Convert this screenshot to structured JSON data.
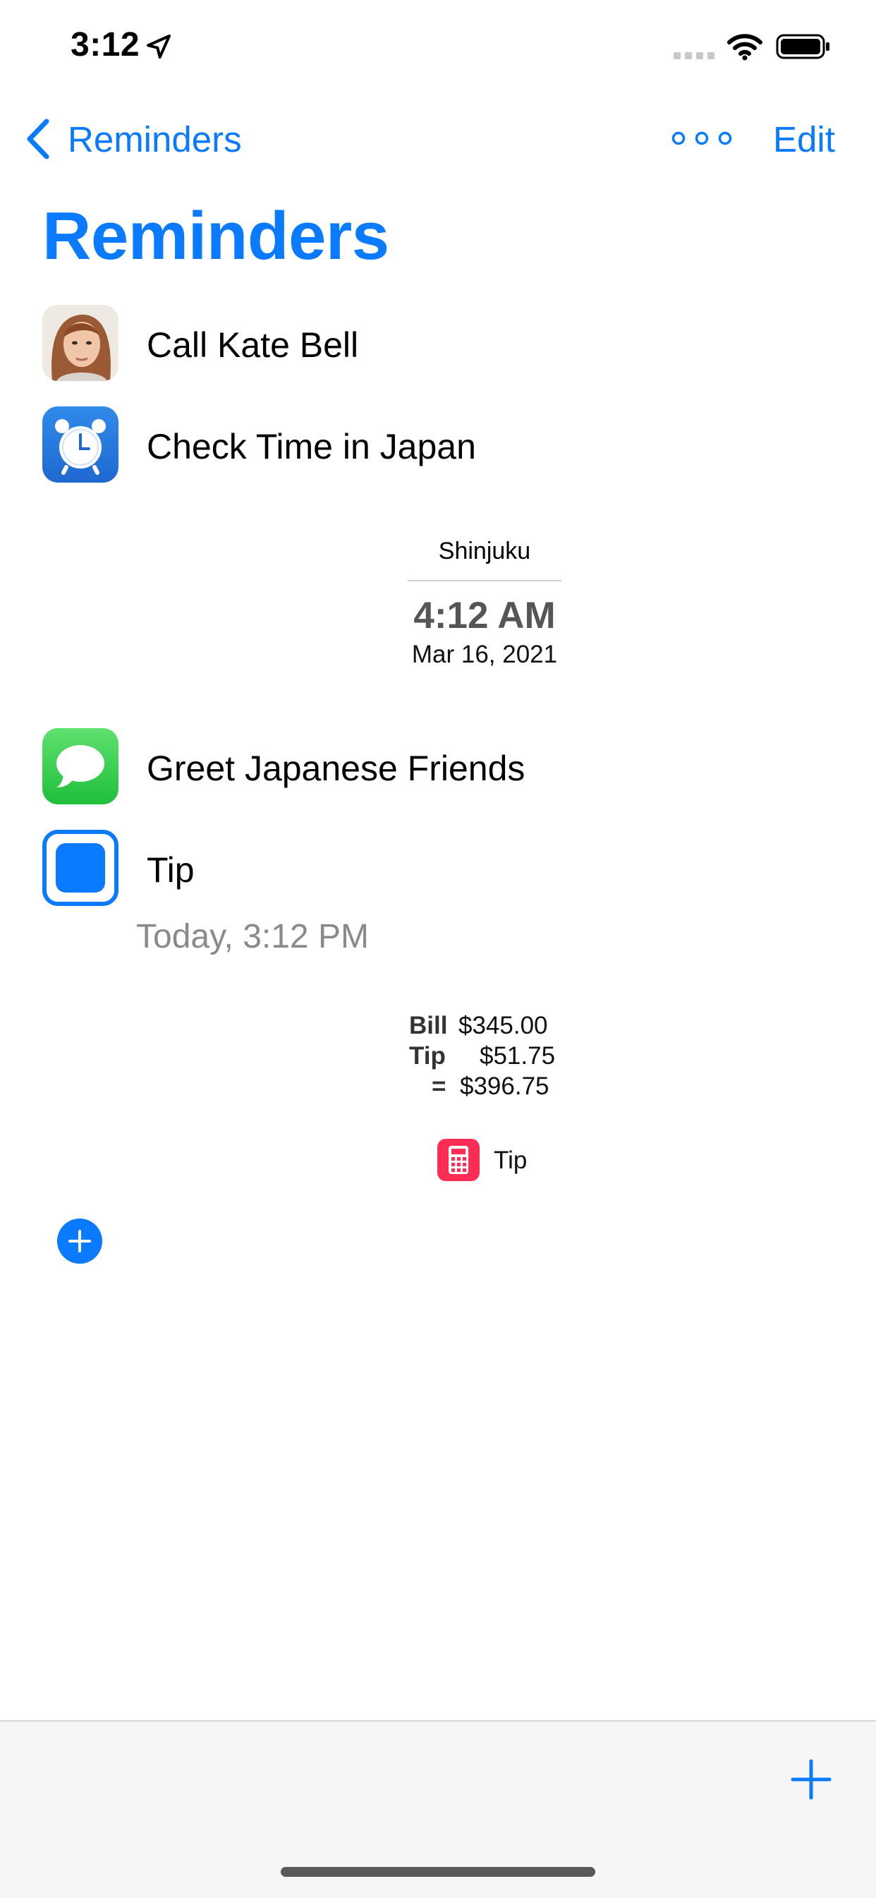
{
  "status_bar": {
    "time": "3:12"
  },
  "nav": {
    "back_label": "Reminders",
    "edit_label": "Edit"
  },
  "title": "Reminders",
  "reminders": [
    {
      "label": "Call Kate Bell",
      "icon": "contact-photo"
    },
    {
      "label": "Check Time in Japan",
      "icon": "alarm-clock-icon"
    },
    {
      "label": "Greet Japanese Friends",
      "icon": "messages-icon"
    },
    {
      "label": "Tip",
      "icon": "checkbox-icon"
    }
  ],
  "clock_widget": {
    "city": "Shinjuku",
    "time": "4:12 AM",
    "date": "Mar 16, 2021"
  },
  "tip_reminder": {
    "due": "Today, 3:12 PM"
  },
  "tip_widget": {
    "bill_label": "Bill",
    "bill_value": "$345.00",
    "tip_label": "Tip",
    "tip_value": "$51.75",
    "total_label": "=",
    "total_value": "$396.75",
    "app_label": "Tip"
  },
  "colors": {
    "accent": "#0a7aff",
    "messages": "#34c759",
    "tip_app": "#ff2d55"
  }
}
